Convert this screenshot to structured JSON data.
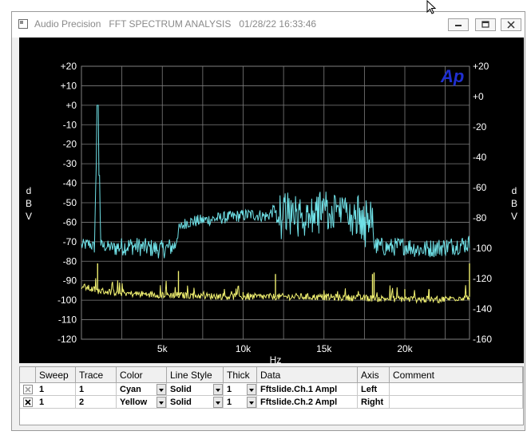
{
  "window": {
    "app_name": "Audio Precision",
    "doc_title": "FFT SPECTRUM ANALYSIS",
    "timestamp": "01/28/22 16:33:46"
  },
  "colors": {
    "plot_bg": "#000000",
    "grid": "#7f7f7f",
    "text": "#ffffff",
    "logo": "#1f2fd0",
    "cyan": "#6fe0e6",
    "yellow": "#f0f070"
  },
  "plot": {
    "logo_text": "Ap",
    "left_axis_label": [
      "d",
      "B",
      "V"
    ],
    "right_axis_label": [
      "d",
      "B",
      "V"
    ],
    "x_label": "Hz"
  },
  "chart_data": {
    "type": "line",
    "xlabel": "Hz",
    "ylabel": "dBV",
    "xlim": [
      0,
      24000
    ],
    "ylim_left": [
      -120,
      20
    ],
    "ylim_right": [
      -160,
      20
    ],
    "x_ticks": [
      5000,
      10000,
      15000,
      20000
    ],
    "x_tick_labels": [
      "5k",
      "10k",
      "15k",
      "20k"
    ],
    "left_ticks": [
      20,
      10,
      0,
      -10,
      -20,
      -30,
      -40,
      -50,
      -60,
      -70,
      -80,
      -90,
      -100,
      -110,
      -120
    ],
    "left_tick_labels": [
      "+20",
      "+10",
      "+0",
      "-10",
      "-20",
      "-30",
      "-40",
      "-50",
      "-60",
      "-70",
      "-80",
      "-90",
      "-100",
      "-110",
      "-120"
    ],
    "right_ticks": [
      20,
      0,
      -20,
      -40,
      -60,
      -80,
      -100,
      -120,
      -140,
      -160
    ],
    "right_tick_labels": [
      "+20",
      "+0",
      "-20",
      "-40",
      "-60",
      "-80",
      "-100",
      "-120",
      "-140",
      "-160"
    ],
    "grid": true,
    "series": [
      {
        "name": "Fftslide.Ch.1 Ampl",
        "color": "cyan",
        "axis": "left",
        "points": [
          [
            0,
            -72
          ],
          [
            500,
            -71
          ],
          [
            800,
            -73
          ],
          [
            1000,
            0
          ],
          [
            1100,
            -36
          ],
          [
            1200,
            -72
          ],
          [
            2000,
            -73
          ],
          [
            3000,
            -72
          ],
          [
            4000,
            -73
          ],
          [
            5000,
            -74
          ],
          [
            5800,
            -72
          ],
          [
            6000,
            -64
          ],
          [
            6500,
            -60
          ],
          [
            7500,
            -59
          ],
          [
            8500,
            -58
          ],
          [
            9500,
            -57
          ],
          [
            10500,
            -56
          ],
          [
            11500,
            -57
          ],
          [
            12000,
            -53
          ],
          [
            13000,
            -53
          ],
          [
            14000,
            -54
          ],
          [
            15000,
            -53
          ],
          [
            16000,
            -54
          ],
          [
            17000,
            -55
          ],
          [
            18000,
            -58
          ],
          [
            18100,
            -72
          ],
          [
            19000,
            -73
          ],
          [
            20000,
            -72
          ],
          [
            21000,
            -74
          ],
          [
            22000,
            -73
          ],
          [
            23000,
            -72
          ],
          [
            24000,
            -71
          ]
        ],
        "noise_db": [
          2,
          2,
          2,
          0,
          0,
          2,
          3,
          3,
          3,
          3,
          2,
          2,
          2,
          2,
          2,
          2,
          2,
          2,
          6,
          6,
          6,
          6,
          6,
          6,
          2,
          3,
          3,
          3,
          3,
          3,
          3,
          2
        ]
      },
      {
        "name": "Fftslide.Ch.2 Ampl",
        "color": "yellow",
        "axis": "right",
        "points": [
          [
            0,
            -125
          ],
          [
            1000,
            -128
          ],
          [
            3000,
            -130
          ],
          [
            6000,
            -131
          ],
          [
            10000,
            -132
          ],
          [
            14000,
            -132
          ],
          [
            18000,
            -133
          ],
          [
            22000,
            -134
          ],
          [
            24000,
            -132
          ]
        ],
        "spikes": [
          [
            1000,
            -110
          ],
          [
            6000,
            -115
          ],
          [
            10000,
            -129
          ],
          [
            12000,
            -117
          ],
          [
            18000,
            -117
          ],
          [
            18100,
            -116
          ],
          [
            20000,
            -127
          ],
          [
            21500,
            -127
          ],
          [
            24000,
            -110
          ]
        ]
      }
    ]
  },
  "table": {
    "headers": [
      "Sweep",
      "Trace",
      "Color",
      "Line Style",
      "Thick",
      "Data",
      "Axis",
      "Comment"
    ],
    "rows": [
      {
        "checked": false,
        "sweep": "1",
        "trace": "1",
        "color": "Cyan",
        "line_style": "Solid",
        "thick": "1",
        "data": "Fftslide.Ch.1 Ampl",
        "axis": "Left",
        "comment": ""
      },
      {
        "checked": true,
        "sweep": "1",
        "trace": "2",
        "color": "Yellow",
        "line_style": "Solid",
        "thick": "1",
        "data": "Fftslide.Ch.2 Ampl",
        "axis": "Right",
        "comment": ""
      }
    ]
  }
}
